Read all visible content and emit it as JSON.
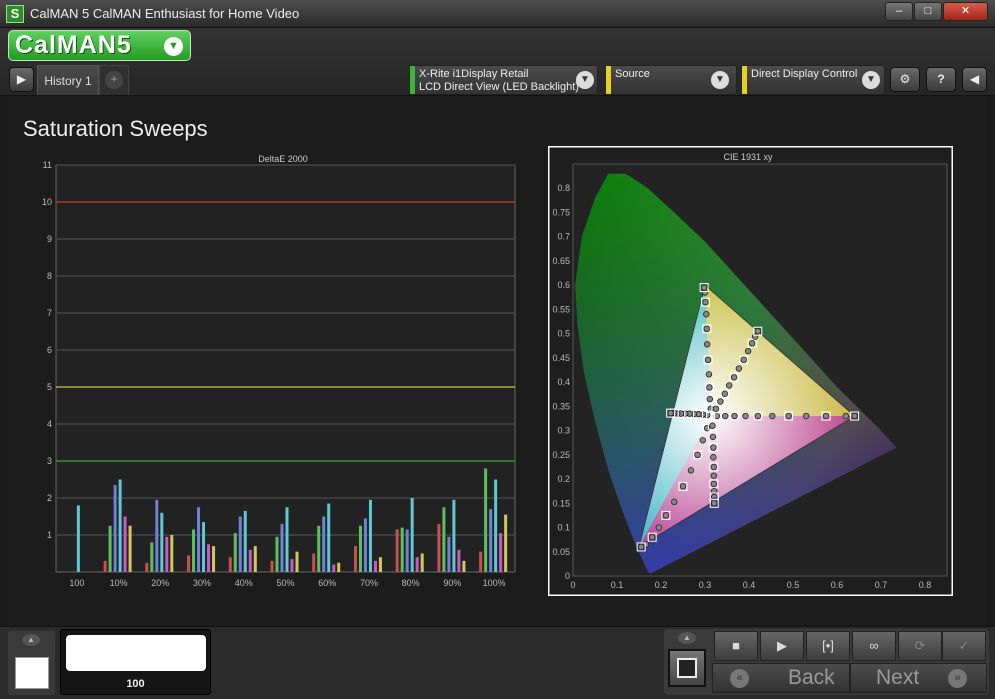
{
  "window": {
    "title": "CalMAN 5 CalMAN Enthusiast for Home Video",
    "app_icon": "S",
    "controls": {
      "minimize": "–",
      "maximize": "□",
      "close": "✕"
    }
  },
  "header": {
    "logo_text": "CalMAN5",
    "tabs": [
      {
        "label": "History 1"
      }
    ],
    "add_tab_icon": "+",
    "devices": [
      {
        "line1": "X-Rite i1Display Retail",
        "line2": "LCD Direct View (LED Backlight)",
        "color": "#3cb43c"
      },
      {
        "line1": "Source",
        "line2": "",
        "color": "#e6d21e"
      },
      {
        "line1": "Direct Display Control",
        "line2": "",
        "color": "#e6d21e"
      }
    ],
    "icons": {
      "menu_left": "play-left-icon",
      "settings": "gear-icon",
      "help": "help-icon",
      "collapse": "arrow-left-icon"
    },
    "help_label": "?"
  },
  "page": {
    "title": "Saturation Sweeps"
  },
  "chart_data": [
    {
      "type": "bar",
      "title": "DeltaE 2000",
      "ylim": [
        0,
        11
      ],
      "yticks": [
        1,
        2,
        3,
        4,
        5,
        6,
        7,
        8,
        9,
        10,
        11
      ],
      "grid": true,
      "threshold_lines": [
        {
          "value": 10,
          "color": "#d03a2a"
        },
        {
          "value": 5,
          "color": "#c8c83a"
        },
        {
          "value": 3,
          "color": "#3aa03a"
        }
      ],
      "categories": [
        "100",
        "10%",
        "20%",
        "30%",
        "40%",
        "50%",
        "60%",
        "70%",
        "80%",
        "90%",
        "100%"
      ],
      "series": [
        {
          "color": "#c85050",
          "values": [
            0,
            0.3,
            0.25,
            0.45,
            0.4,
            0.3,
            0.5,
            0.7,
            1.15,
            1.3,
            0.55
          ]
        },
        {
          "color": "#5fbf5f",
          "values": [
            0,
            1.25,
            0.8,
            1.15,
            1.05,
            0.95,
            1.25,
            1.25,
            1.2,
            1.75,
            2.8
          ]
        },
        {
          "color": "#6e82d8",
          "values": [
            0,
            2.35,
            1.95,
            1.75,
            1.5,
            1.3,
            1.5,
            1.45,
            1.15,
            0.95,
            1.7
          ]
        },
        {
          "color": "#5fc8d2",
          "values": [
            1.8,
            2.5,
            1.6,
            1.35,
            1.65,
            1.75,
            1.85,
            1.95,
            2.0,
            1.95,
            2.5
          ]
        },
        {
          "color": "#c85ac8",
          "values": [
            0,
            1.5,
            0.95,
            0.75,
            0.6,
            0.35,
            0.2,
            0.3,
            0.4,
            0.6,
            1.05
          ]
        },
        {
          "color": "#d2c85a",
          "values": [
            0,
            1.25,
            1.0,
            0.7,
            0.7,
            0.55,
            0.25,
            0.4,
            0.5,
            0.3,
            1.55
          ]
        }
      ]
    },
    {
      "type": "scatter",
      "title": "CIE 1931 xy",
      "xlim": [
        0,
        0.85
      ],
      "ylim": [
        0,
        0.85
      ],
      "xticks": [
        0,
        0.1,
        0.2,
        0.3,
        0.4,
        0.5,
        0.6,
        0.7,
        0.8
      ],
      "yticks": [
        0,
        0.05,
        0.1,
        0.15,
        0.2,
        0.25,
        0.3,
        0.35,
        0.4,
        0.45,
        0.5,
        0.55,
        0.6,
        0.65,
        0.7,
        0.75,
        0.8
      ],
      "gamut": {
        "red": [
          0.64,
          0.33
        ],
        "green": [
          0.3,
          0.6
        ],
        "blue": [
          0.15,
          0.06
        ],
        "white": [
          0.3127,
          0.329
        ]
      },
      "series": [
        {
          "name": "red",
          "marker": "circle",
          "x": [
            0.327,
            0.346,
            0.367,
            0.392,
            0.42,
            0.453,
            0.49,
            0.53,
            0.575,
            0.62,
            0.64
          ],
          "y": [
            0.33,
            0.33,
            0.33,
            0.33,
            0.33,
            0.33,
            0.33,
            0.33,
            0.33,
            0.33,
            0.33
          ]
        },
        {
          "name": "green",
          "marker": "circle",
          "x": [
            0.313,
            0.311,
            0.31,
            0.309,
            0.307,
            0.305,
            0.304,
            0.303,
            0.301,
            0.3,
            0.298
          ],
          "y": [
            0.345,
            0.365,
            0.389,
            0.416,
            0.446,
            0.478,
            0.51,
            0.54,
            0.565,
            0.585,
            0.595
          ]
        },
        {
          "name": "blue",
          "marker": "circle",
          "x": [
            0.305,
            0.295,
            0.283,
            0.268,
            0.25,
            0.23,
            0.211,
            0.195,
            0.18,
            0.166,
            0.155
          ],
          "y": [
            0.305,
            0.28,
            0.25,
            0.218,
            0.185,
            0.153,
            0.125,
            0.1,
            0.08,
            0.065,
            0.06
          ]
        },
        {
          "name": "cyan",
          "marker": "circle",
          "x": [
            0.305,
            0.295,
            0.285,
            0.275,
            0.265,
            0.255,
            0.245,
            0.237,
            0.23,
            0.225,
            0.222
          ],
          "y": [
            0.332,
            0.333,
            0.334,
            0.334,
            0.335,
            0.335,
            0.335,
            0.335,
            0.336,
            0.336,
            0.336
          ]
        },
        {
          "name": "magenta",
          "marker": "circle",
          "x": [
            0.317,
            0.318,
            0.319,
            0.319,
            0.32,
            0.32,
            0.32,
            0.321,
            0.321,
            0.321,
            0.321
          ],
          "y": [
            0.31,
            0.287,
            0.265,
            0.245,
            0.225,
            0.207,
            0.19,
            0.175,
            0.163,
            0.155,
            0.15
          ]
        },
        {
          "name": "yellow",
          "marker": "circle",
          "x": [
            0.325,
            0.335,
            0.345,
            0.355,
            0.366,
            0.377,
            0.388,
            0.398,
            0.407,
            0.414,
            0.42
          ],
          "y": [
            0.345,
            0.36,
            0.376,
            0.393,
            0.41,
            0.428,
            0.446,
            0.464,
            0.48,
            0.494,
            0.505
          ]
        }
      ]
    }
  ],
  "bottom": {
    "patch_label": "100",
    "buttons": {
      "stop": "■",
      "play": "▶",
      "fit": "[•]",
      "loop": "∞",
      "refresh": "⟳",
      "check": "✓",
      "back": "Back",
      "next": "Next",
      "back_arrow": "«",
      "next_arrow": "»",
      "up_arrow": "▲"
    },
    "icons": {
      "stop": "stop-icon",
      "play": "play-icon",
      "fit": "fit-icon",
      "loop": "loop-icon",
      "refresh": "refresh-icon",
      "check": "check-icon"
    }
  }
}
